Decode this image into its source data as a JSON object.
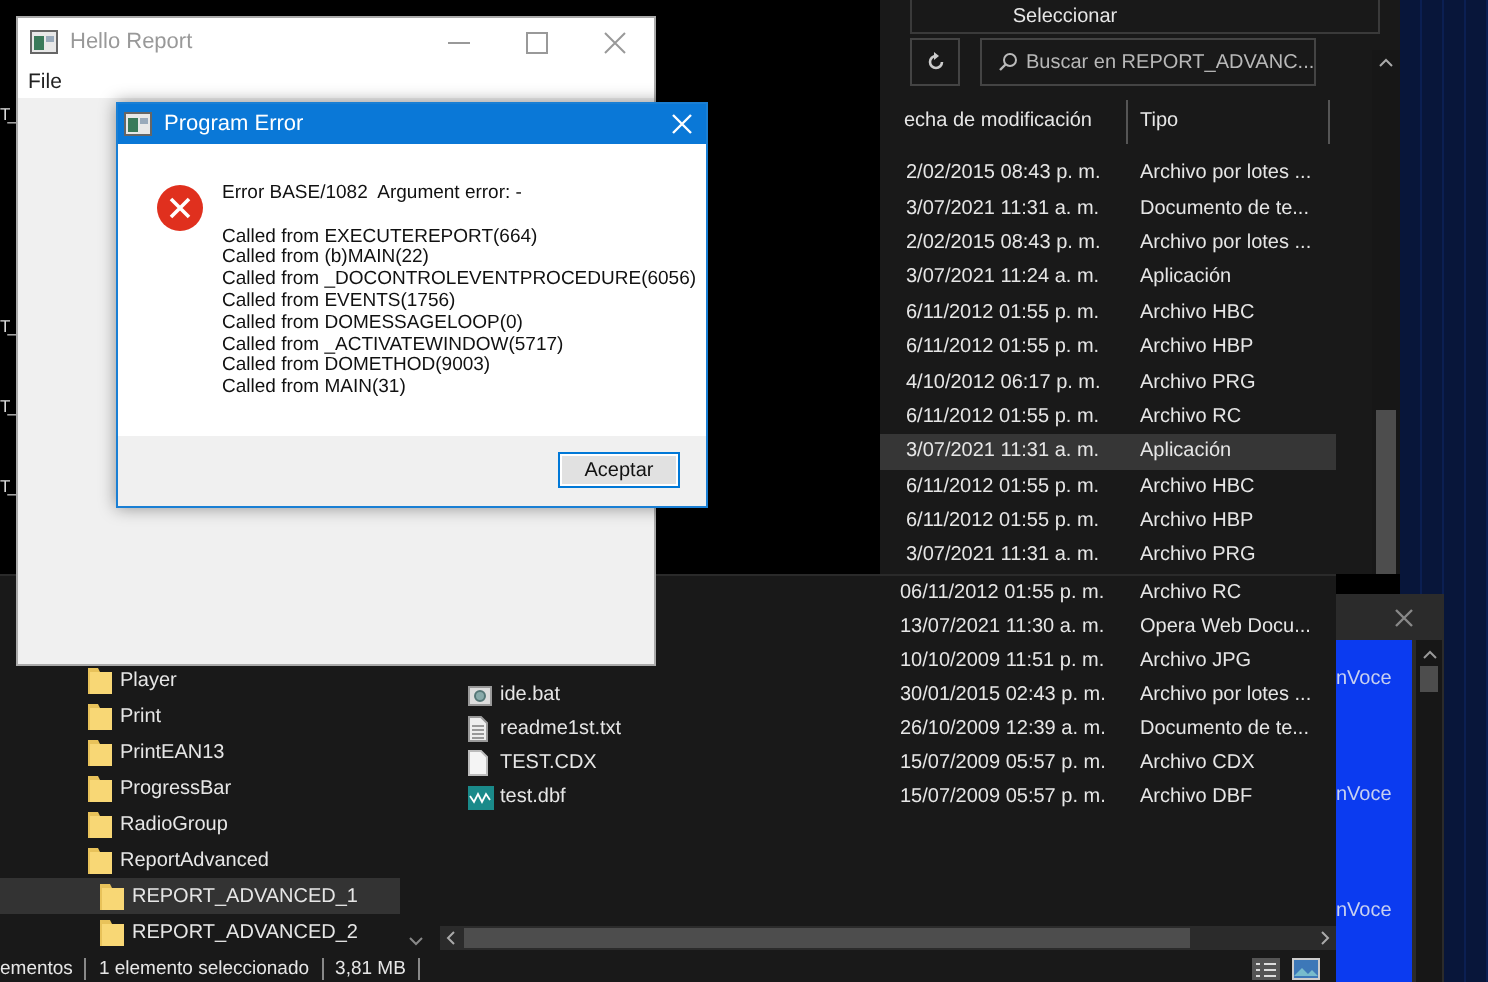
{
  "desktop_edge_labels": [
    "T_",
    "T_",
    "T_",
    "T_"
  ],
  "explorer_top": {
    "toolbar_label": "Seleccionar",
    "search": {
      "placeholder": "Buscar en REPORT_ADVANC..."
    },
    "columns": [
      "echa de modificación",
      "Tipo"
    ],
    "rows": [
      {
        "date": "2/02/2015 08:43 p. m.",
        "type": "Archivo por lotes ...",
        "selected": false
      },
      {
        "date": "3/07/2021 11:31 a. m.",
        "type": "Documento de te...",
        "selected": false
      },
      {
        "date": "2/02/2015 08:43 p. m.",
        "type": "Archivo por lotes ...",
        "selected": false
      },
      {
        "date": "3/07/2021 11:24 a. m.",
        "type": "Aplicación",
        "selected": false
      },
      {
        "date": "6/11/2012 01:55 p. m.",
        "type": "Archivo HBC",
        "selected": false
      },
      {
        "date": "6/11/2012 01:55 p. m.",
        "type": "Archivo HBP",
        "selected": false
      },
      {
        "date": "4/10/2012 06:17 p. m.",
        "type": "Archivo PRG",
        "selected": false
      },
      {
        "date": "6/11/2012 01:55 p. m.",
        "type": "Archivo RC",
        "selected": false
      },
      {
        "date": "3/07/2021 11:31 a. m.",
        "type": "Aplicación",
        "selected": true
      },
      {
        "date": "6/11/2012 01:55 p. m.",
        "type": "Archivo HBC",
        "selected": false
      },
      {
        "date": "6/11/2012 01:55 p. m.",
        "type": "Archivo HBP",
        "selected": false
      },
      {
        "date": "3/07/2021 11:31 a. m.",
        "type": "Archivo PRG",
        "selected": false
      }
    ]
  },
  "explorer_bottom": {
    "tree": [
      {
        "label": "Player",
        "selected": false
      },
      {
        "label": "Print",
        "selected": false
      },
      {
        "label": "PrintEAN13",
        "selected": false
      },
      {
        "label": "ProgressBar",
        "selected": false
      },
      {
        "label": "RadioGroup",
        "selected": false
      },
      {
        "label": "ReportAdvanced",
        "selected": false,
        "children": [
          {
            "label": "REPORT_ADVANCED_1",
            "selected": true
          },
          {
            "label": "REPORT_ADVANCED_2",
            "selected": false
          }
        ]
      }
    ],
    "files": [
      {
        "date": "06/11/2012 01:55 p. m.",
        "type": "Archivo RC"
      },
      {
        "date": "13/07/2021 11:30 a. m.",
        "type": "Opera Web Docu..."
      },
      {
        "date": "10/10/2009 11:51 p. m.",
        "type": "Archivo JPG"
      },
      {
        "name": "ide.bat",
        "kind": "batch",
        "date": "30/01/2015 02:43 p. m.",
        "type": "Archivo por lotes ..."
      },
      {
        "name": "readme1st.txt",
        "kind": "text",
        "date": "26/10/2009 12:39 a. m.",
        "type": "Documento de te..."
      },
      {
        "name": "TEST.CDX",
        "kind": "blank",
        "date": "15/07/2009 05:57 p. m.",
        "type": "Archivo CDX"
      },
      {
        "name": "test.dbf",
        "kind": "database",
        "date": "15/07/2009 05:57 p. m.",
        "type": "Archivo DBF"
      }
    ],
    "status_bar": [
      "ementos",
      "1 elemento seleccionado",
      "3,81 MB"
    ]
  },
  "background_window": {
    "labels": [
      "nVoce",
      "nVoce",
      "nVoce"
    ]
  },
  "hello_window": {
    "title": "Hello Report",
    "menu": [
      "File"
    ]
  },
  "error_dialog": {
    "title": "Program Error",
    "message": "Error BASE/1082  Argument error: -",
    "call_stack": [
      "Called from EXECUTEREPORT(664)",
      "Called from (b)MAIN(22)",
      "Called from _DOCONTROLEVENTPROCEDURE(6056)",
      "Called from EVENTS(1756)",
      "Called from DOMESSAGELOOP(0)",
      "Called from _ACTIVATEWINDOW(5717)",
      "Called from DOMETHOD(9003)",
      "Called from MAIN(31)"
    ],
    "buttons": [
      "Aceptar"
    ]
  }
}
